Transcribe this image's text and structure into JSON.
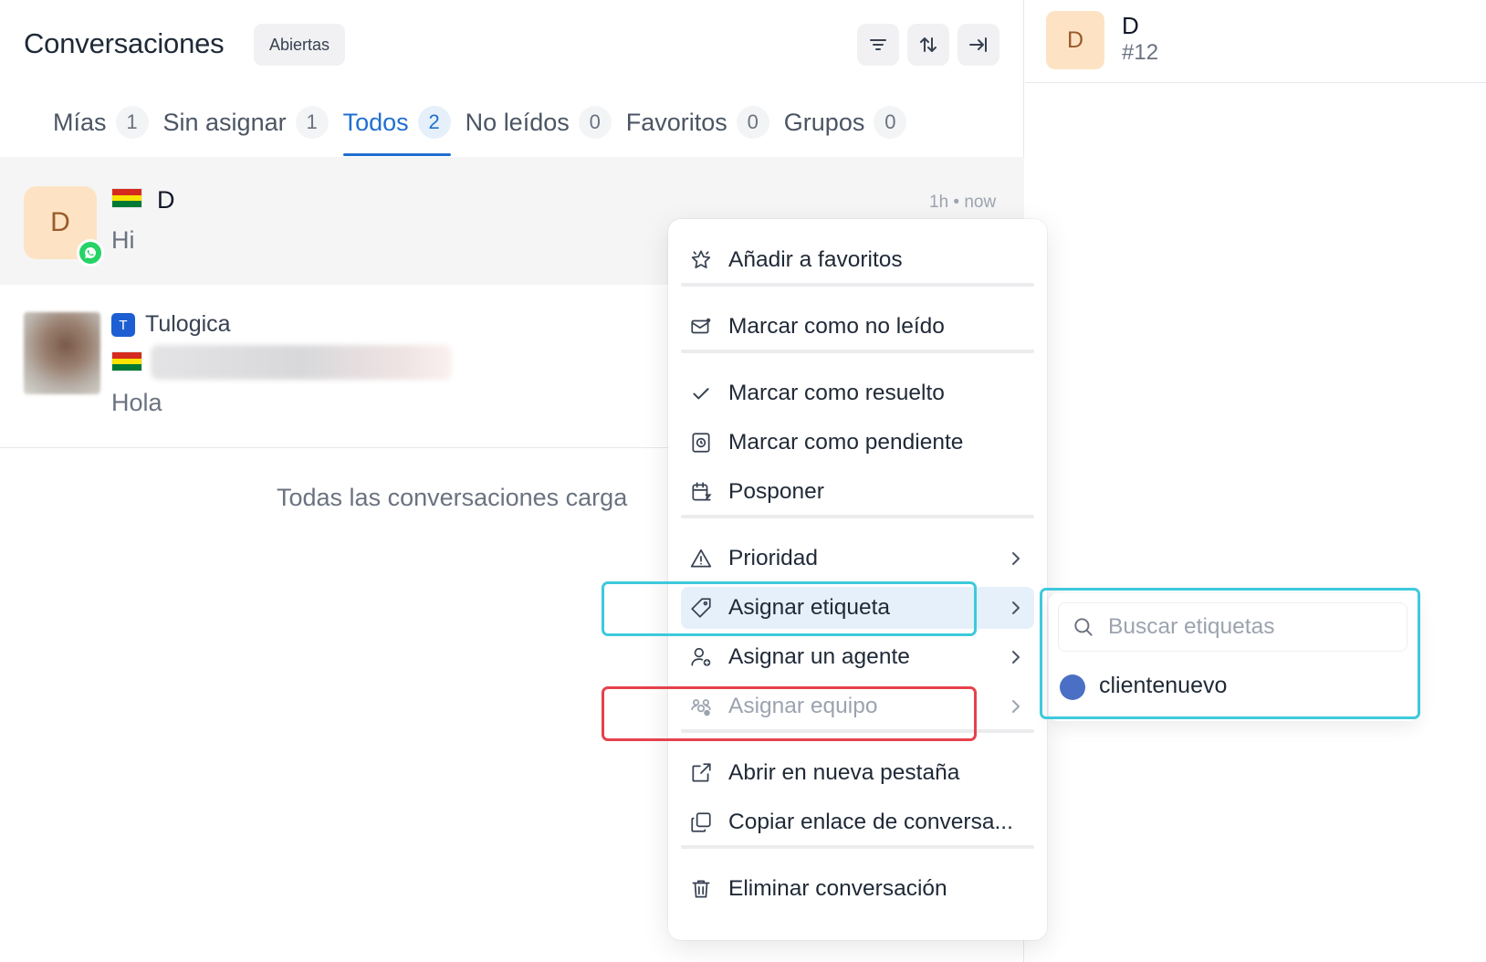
{
  "header": {
    "title": "Conversaciones",
    "status_filter": "Abiertas",
    "icons": [
      "filter-icon",
      "sort-icon",
      "collapse-panel-icon"
    ]
  },
  "tabs": [
    {
      "label": "Mías",
      "count": "1"
    },
    {
      "label": "Sin asignar",
      "count": "1"
    },
    {
      "label": "Todos",
      "count": "2",
      "active": true
    },
    {
      "label": "No leídos",
      "count": "0"
    },
    {
      "label": "Favoritos",
      "count": "0"
    },
    {
      "label": "Grupos",
      "count": "0"
    }
  ],
  "conversations": [
    {
      "avatar_initial": "D",
      "name": "D",
      "last_message": "Hi",
      "time": "1h • now",
      "channel": "whatsapp"
    },
    {
      "inbox_badge": "T",
      "inbox_name": "Tulogica",
      "last_message": "Hola"
    }
  ],
  "list_footer": "Todas las conversaciones carga",
  "detail": {
    "avatar_initial": "D",
    "name": "D",
    "id": "#12"
  },
  "context_menu": {
    "items": [
      {
        "label": "Añadir a favoritos",
        "icon": "star-icon"
      },
      {
        "label": "Marcar como no leído",
        "icon": "mail-icon"
      },
      {
        "label": "Marcar como resuelto",
        "icon": "check-icon"
      },
      {
        "label": "Marcar como pendiente",
        "icon": "pending-icon"
      },
      {
        "label": "Posponer",
        "icon": "snooze-icon"
      },
      {
        "label": "Prioridad",
        "icon": "warning-icon",
        "submenu": true
      },
      {
        "label": "Asignar etiqueta",
        "icon": "tag-icon",
        "submenu": true,
        "highlighted": true
      },
      {
        "label": "Asignar un agente",
        "icon": "agent-icon",
        "submenu": true
      },
      {
        "label": "Asignar equipo",
        "icon": "team-icon",
        "submenu": true,
        "disabled": true
      },
      {
        "label": "Abrir en nueva pestaña",
        "icon": "external-link-icon"
      },
      {
        "label": "Copiar enlace de conversa...",
        "icon": "copy-link-icon"
      },
      {
        "label": "Eliminar conversación",
        "icon": "trash-icon"
      }
    ]
  },
  "label_submenu": {
    "search_placeholder": "Buscar etiquetas",
    "labels": [
      {
        "name": "clientenuevo",
        "color": "#4a6fc4"
      }
    ]
  },
  "colors": {
    "accent": "#1f6fd1",
    "annotation_cyan": "#3ec9dc",
    "annotation_red": "#e5414b",
    "whatsapp": "#25d366"
  }
}
